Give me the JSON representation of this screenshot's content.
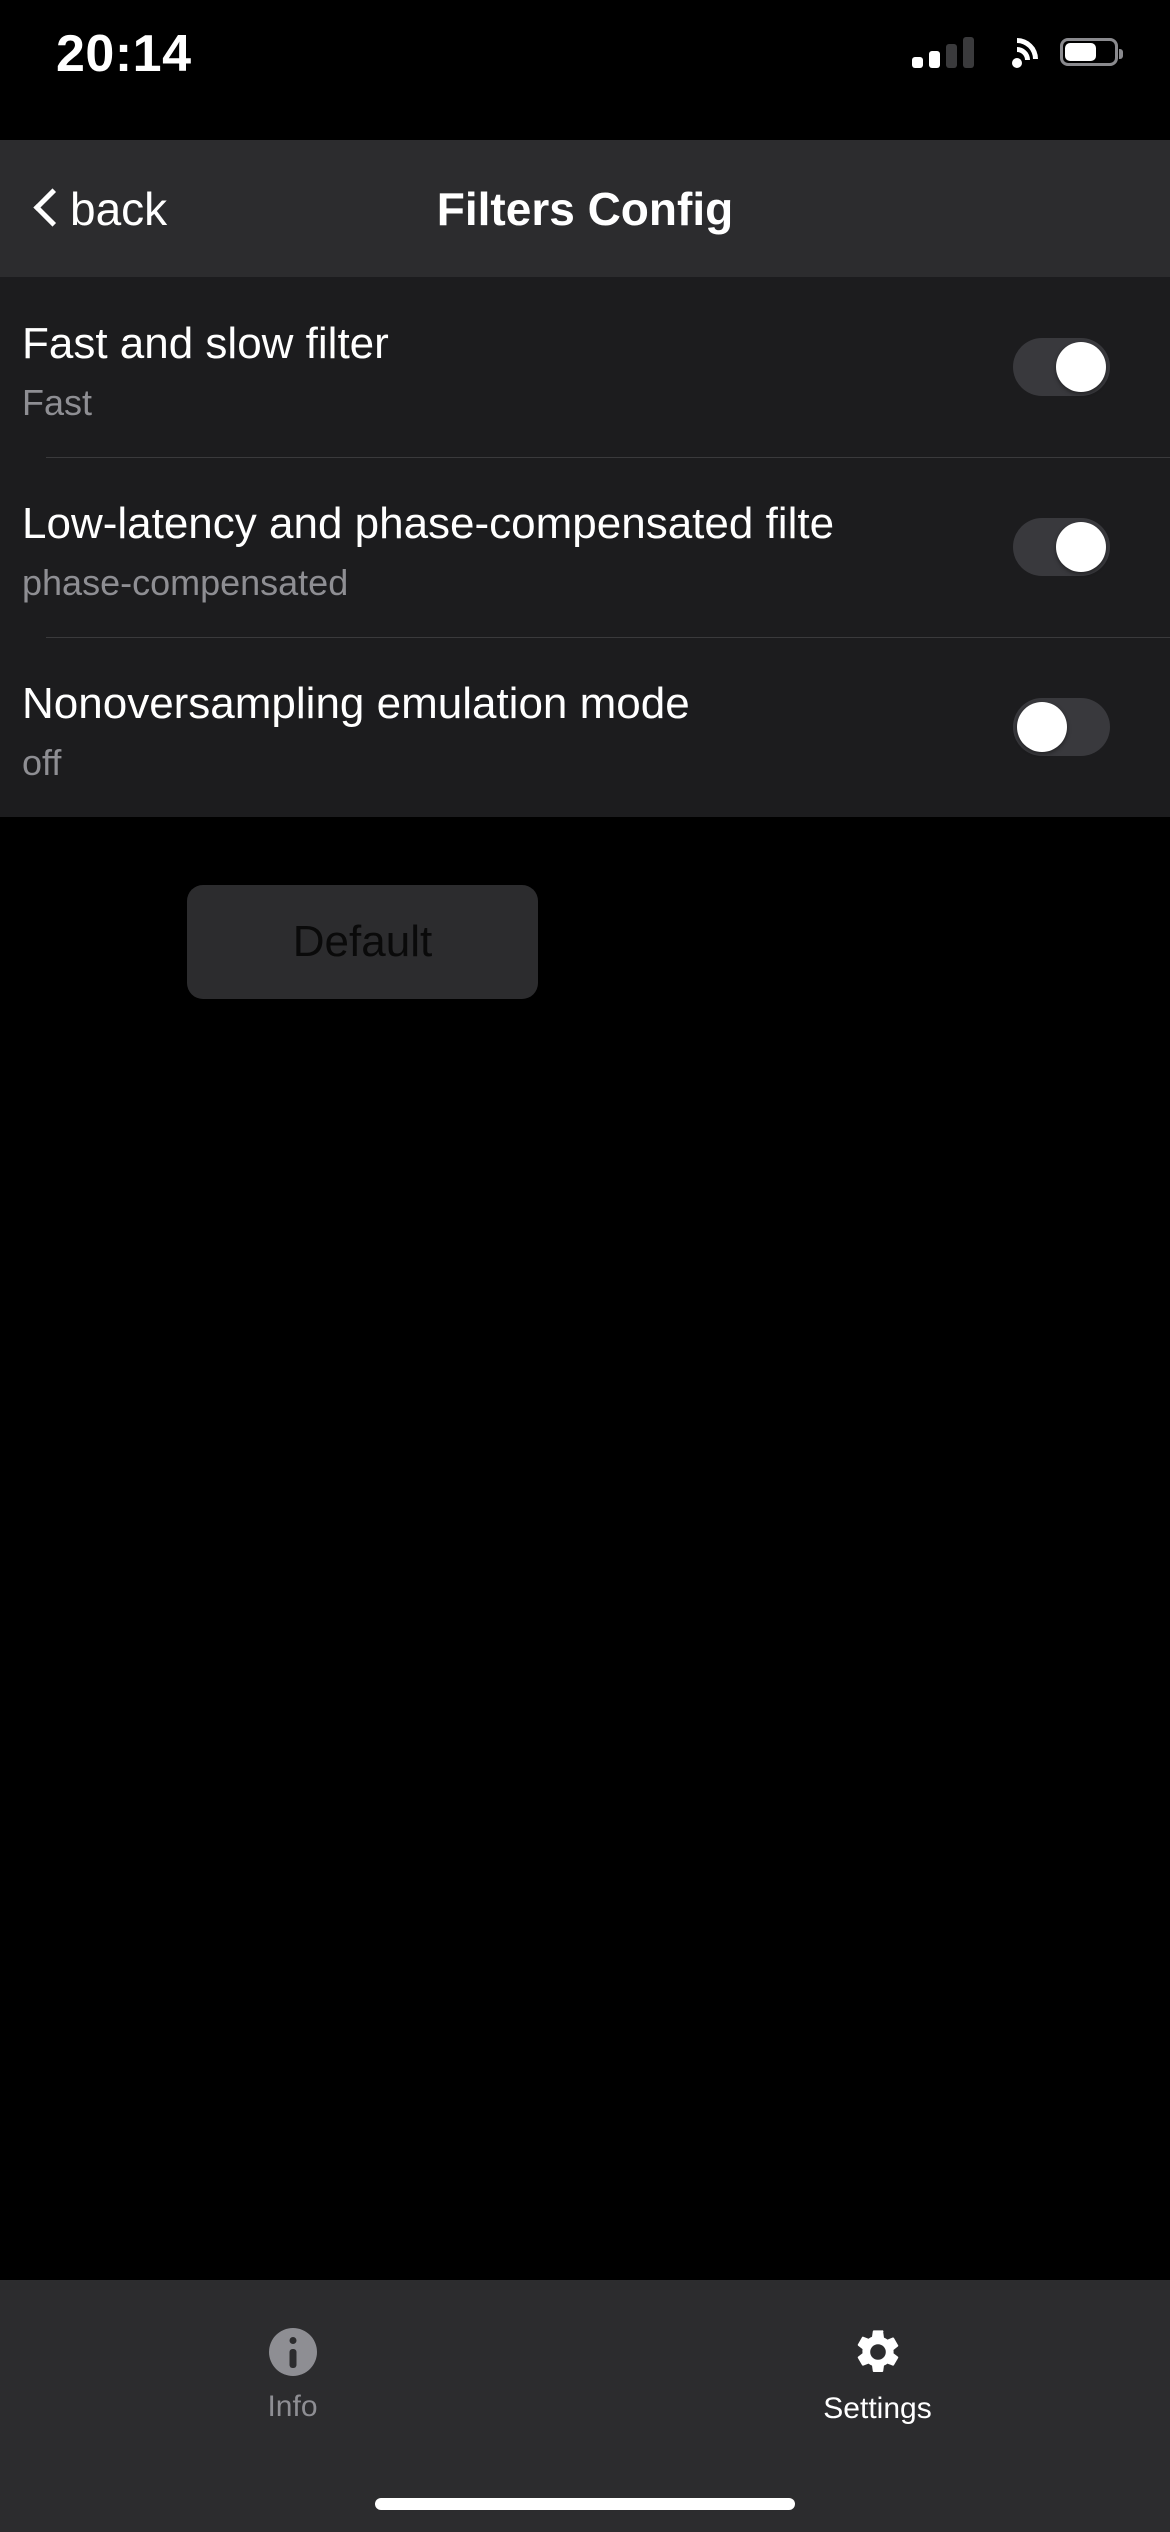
{
  "statusbar": {
    "time": "20:14",
    "cellular_icon": "cellular-signal-icon",
    "wifi_icon": "wifi-icon",
    "battery_icon": "battery-icon",
    "battery_level": 62
  },
  "navbar": {
    "back_label": "back",
    "back_icon": "chevron-left-icon",
    "title": "Filters Config"
  },
  "settings": {
    "rows": [
      {
        "title": "Fast and slow filter",
        "subtitle": "Fast",
        "toggle_state": "on"
      },
      {
        "title": "Low-latency and phase-compensated filte",
        "subtitle": "phase-compensated",
        "toggle_state": "on"
      },
      {
        "title": "Nonoversampling emulation mode",
        "subtitle": "off",
        "toggle_state": "off"
      }
    ]
  },
  "actions": {
    "default_button": "Default"
  },
  "tabbar": {
    "tabs": [
      {
        "label": "Info",
        "icon": "info-circle-icon",
        "active": false
      },
      {
        "label": "Settings",
        "icon": "gear-icon",
        "active": true
      }
    ]
  },
  "colors": {
    "background": "#000000",
    "list_background": "#1c1c1e",
    "bar_background": "#2c2c2e",
    "separator": "#3a3a3c",
    "text_primary": "#ffffff",
    "text_secondary": "#8e8e93",
    "switch_track": "#39393d",
    "switch_knob": "#ffffff",
    "default_button_text": "#0a0a0a"
  }
}
